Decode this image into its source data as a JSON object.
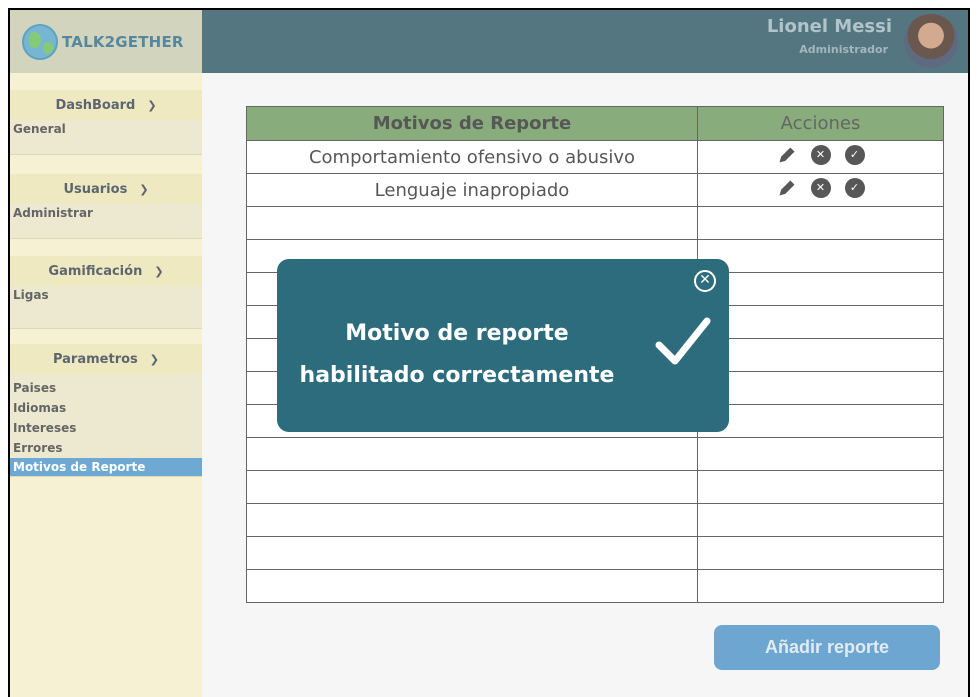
{
  "logo": {
    "text": "TALK2GETHER"
  },
  "header": {
    "user_name": "Lionel Messi",
    "user_role": "Administrador"
  },
  "sidebar": {
    "groups": [
      {
        "title": "DashBoard",
        "items": [
          "General"
        ]
      },
      {
        "title": "Usuarios",
        "items": [
          "Administrar"
        ]
      },
      {
        "title": "Gamificación",
        "items": [
          "Ligas"
        ]
      },
      {
        "title": "Parametros",
        "items": [
          "Paises",
          "Idiomas",
          "Intereses",
          "Errores",
          "Motivos de Reporte"
        ]
      }
    ],
    "active_item": "Motivos de Reporte"
  },
  "table": {
    "headers": [
      "Motivos de Reporte",
      "Acciones"
    ],
    "rows": [
      "Comportamiento ofensivo o abusivo",
      "Lenguaje inapropiado"
    ],
    "empty_rows": 12
  },
  "add_button": {
    "label": "Añadir reporte"
  },
  "modal": {
    "message_line1": "Motivo de reporte",
    "message_line2": "habilitado correctamente"
  },
  "colors": {
    "header": "#2f5865",
    "modal": "#2c6c7c",
    "table_header": "#6e9a5f",
    "accent": "#4d93c6"
  }
}
